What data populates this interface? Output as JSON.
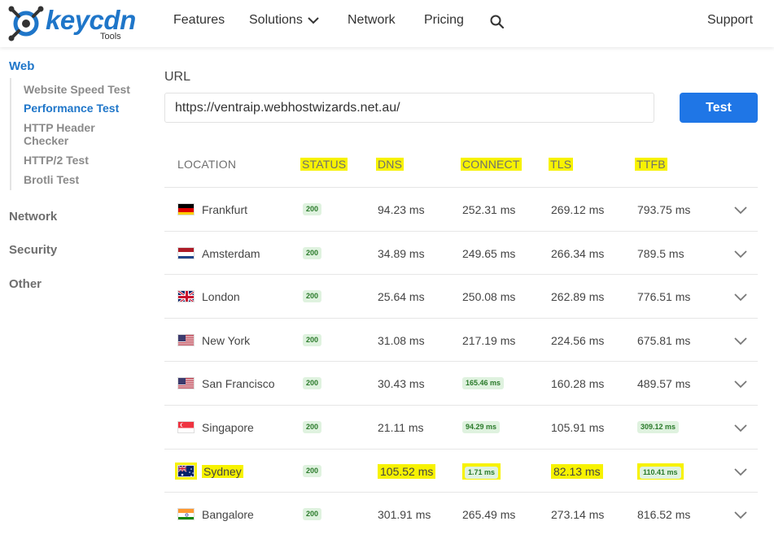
{
  "header": {
    "logo_text": "keycdn",
    "logo_sub": "Tools",
    "nav": [
      "Features",
      "Solutions",
      "Network",
      "Pricing"
    ],
    "support": "Support"
  },
  "sidebar": {
    "sections": [
      "Web",
      "Network",
      "Security",
      "Other"
    ],
    "web_items": [
      "Website Speed Test",
      "Performance Test",
      "HTTP Header Checker",
      "HTTP/2 Test",
      "Brotli Test"
    ],
    "active_item": "Performance Test"
  },
  "form": {
    "url_label": "URL",
    "url_value": "https://ventraip.webhostwizards.net.au/",
    "test_label": "Test"
  },
  "table": {
    "headers": [
      "LOCATION",
      "STATUS",
      "DNS",
      "CONNECT",
      "TLS",
      "TTFB"
    ],
    "highlighted_headers": [
      "STATUS",
      "DNS",
      "CONNECT",
      "TLS",
      "TTFB"
    ],
    "rows": [
      {
        "location": "Frankfurt",
        "flag": "germany-flag",
        "status": "200",
        "dns": "94.23 ms",
        "connect": "252.31 ms",
        "tls": "269.12 ms",
        "ttfb": "793.75 ms"
      },
      {
        "location": "Amsterdam",
        "flag": "netherlands-flag",
        "status": "200",
        "dns": "34.89 ms",
        "connect": "249.65 ms",
        "tls": "266.34 ms",
        "ttfb": "789.5 ms"
      },
      {
        "location": "London",
        "flag": "uk-flag",
        "status": "200",
        "dns": "25.64 ms",
        "connect": "250.08 ms",
        "tls": "262.89 ms",
        "ttfb": "776.51 ms"
      },
      {
        "location": "New York",
        "flag": "us-flag",
        "status": "200",
        "dns": "31.08 ms",
        "connect": "217.19 ms",
        "tls": "224.56 ms",
        "ttfb": "675.81 ms"
      },
      {
        "location": "San Francisco",
        "flag": "us-flag",
        "status": "200",
        "dns": "30.43 ms",
        "connect": "165.46 ms",
        "tls": "160.28 ms",
        "ttfb": "489.57 ms"
      },
      {
        "location": "Singapore",
        "flag": "singapore-flag",
        "status": "200",
        "dns": "21.11 ms",
        "connect": "94.29 ms",
        "tls": "105.91 ms",
        "ttfb": "309.12 ms"
      },
      {
        "location": "Sydney",
        "flag": "australia-flag",
        "status": "200",
        "dns": "105.52 ms",
        "connect": "1.71 ms",
        "tls": "82.13 ms",
        "ttfb": "110.41 ms"
      },
      {
        "location": "Bangalore",
        "flag": "india-flag",
        "status": "200",
        "dns": "301.91 ms",
        "connect": "265.49 ms",
        "tls": "273.14 ms",
        "ttfb": "816.52 ms"
      }
    ],
    "badged_cells": [
      "San Francisco.connect",
      "Singapore.connect",
      "Singapore.ttfb",
      "Sydney.connect",
      "Sydney.ttfb"
    ],
    "highlighted_row": "Sydney"
  },
  "colors": {
    "brand_blue": "#1f76c9",
    "button_blue": "#1f76e6",
    "highlight_yellow": "#f7f200",
    "badge_green_bg": "#dff2df",
    "badge_green_text": "#2a7a2a"
  }
}
